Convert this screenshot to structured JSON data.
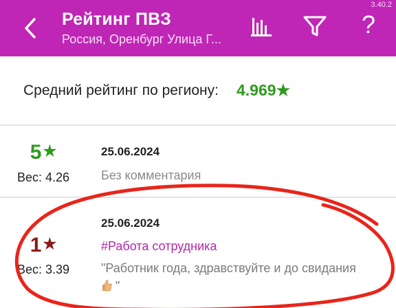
{
  "app": {
    "version": "3.40.2"
  },
  "header": {
    "title": "Рейтинг ПВЗ",
    "subtitle": "Россия, Оренбург Улица Г...",
    "back_icon": "chevron-left-icon",
    "chart_icon": "bar-chart-icon",
    "filter_icon": "filter-icon",
    "help_label": "?",
    "bg_color": "#c026b6"
  },
  "region": {
    "label": "Средний рейтинг по региону:",
    "value": "4.969",
    "star": "★",
    "value_color": "#2f9a1e"
  },
  "reviews": [
    {
      "score": "5",
      "star": "★",
      "score_color": "#2f9a1e",
      "weight": "Вес: 4.26",
      "date": "25.06.2024",
      "comment": "Без комментария"
    },
    {
      "score": "1",
      "star": "★",
      "score_color": "#8b1a1a",
      "weight": "Вес: 3.39",
      "date": "25.06.2024",
      "tag": "#Работа сотрудника",
      "comment_open": "\"Работник года, здравствуйте и до свидания",
      "emoji": "thumbs-up-icon",
      "comment_close": "\""
    }
  ],
  "annotation": {
    "color": "#e8251b"
  }
}
